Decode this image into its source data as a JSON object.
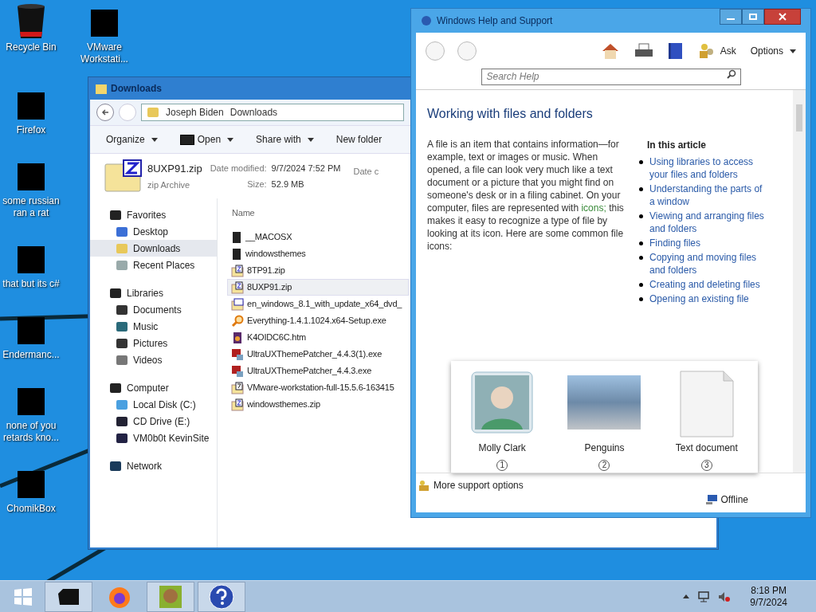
{
  "desktop_icons": [
    {
      "label": "Recycle Bin",
      "kind": "bin"
    },
    {
      "label": "VMware Workstati...",
      "kind": "redacted"
    },
    {
      "label": "Firefox",
      "kind": "redacted"
    },
    {
      "label": "some russian ran a rat",
      "kind": "redacted"
    },
    {
      "label": "that but its c#",
      "kind": "redacted"
    },
    {
      "label": "Endermanc...",
      "kind": "redacted"
    },
    {
      "label": "none of you retards kno...",
      "kind": "redacted"
    },
    {
      "label": "ChomikBox",
      "kind": "redacted"
    }
  ],
  "explorer": {
    "title": "Downloads",
    "breadcrumb": [
      "Joseph Biden",
      "Downloads"
    ],
    "toolbar": [
      {
        "label": "Organize",
        "dropdown": true,
        "kind": "plain"
      },
      {
        "label": "Open",
        "dropdown": true,
        "kind": "sevenzip"
      },
      {
        "label": "Share with",
        "dropdown": true,
        "kind": "plain"
      },
      {
        "label": "New folder",
        "dropdown": false,
        "kind": "plain"
      }
    ],
    "details": {
      "name": "8UXP91.zip",
      "type": "zip Archive",
      "modified_label": "Date modified:",
      "modified": "9/7/2024 7:52 PM",
      "size_label": "Size:",
      "size": "52.9 MB",
      "created_label": "Date c"
    },
    "nav": [
      {
        "label": "Favorites",
        "kind": "favorites",
        "children": [
          {
            "label": "Desktop",
            "kind": "desktop",
            "selected": false
          },
          {
            "label": "Downloads",
            "kind": "downloads",
            "selected": true
          },
          {
            "label": "Recent Places",
            "kind": "recent",
            "selected": false
          }
        ]
      },
      {
        "label": "Libraries",
        "kind": "libraries",
        "children": [
          {
            "label": "Documents",
            "kind": "documents",
            "selected": false
          },
          {
            "label": "Music",
            "kind": "music",
            "selected": false
          },
          {
            "label": "Pictures",
            "kind": "pictures",
            "selected": false
          },
          {
            "label": "Videos",
            "kind": "videos",
            "selected": false
          }
        ]
      },
      {
        "label": "Computer",
        "kind": "computer",
        "children": [
          {
            "label": "Local Disk (C:)",
            "kind": "disk",
            "selected": false
          },
          {
            "label": "CD Drive (E:)",
            "kind": "cd",
            "selected": false
          },
          {
            "label": "VM0b0t KevinSite",
            "kind": "network-drive",
            "selected": false
          }
        ]
      },
      {
        "label": "Network",
        "kind": "network"
      }
    ],
    "column": "Name",
    "files": [
      {
        "name": "__MACOSX",
        "kind": "folder",
        "selected": false
      },
      {
        "name": "windowsthemes",
        "kind": "folder",
        "selected": false
      },
      {
        "name": "8TP91.zip",
        "kind": "zip",
        "selected": false
      },
      {
        "name": "8UXP91.zip",
        "kind": "zip",
        "selected": true
      },
      {
        "name": "en_windows_8.1_with_update_x64_dvd_",
        "kind": "iso",
        "selected": false
      },
      {
        "name": "Everything-1.4.1.1024.x64-Setup.exe",
        "kind": "search-exe",
        "selected": false
      },
      {
        "name": "K4OIDC6C.htm",
        "kind": "htm",
        "selected": false
      },
      {
        "name": "UltraUXThemePatcher_4.4.3(1).exe",
        "kind": "patcher",
        "selected": false
      },
      {
        "name": "UltraUXThemePatcher_4.4.3.exe",
        "kind": "patcher",
        "selected": false
      },
      {
        "name": "VMware-workstation-full-15.5.6-163415",
        "kind": "sevenzip",
        "selected": false
      },
      {
        "name": "windowsthemes.zip",
        "kind": "zip",
        "selected": false
      }
    ]
  },
  "help": {
    "title": "Windows Help and Support",
    "ask": "Ask",
    "options": "Options",
    "search": {
      "placeholder": "Search Help"
    },
    "article_title": "Working with files and folders",
    "paragraph_before": "A file is an item that contains information—for example, text or images or music. When opened, a file can look very much like a text document or a picture that you might find on someone's desk or in a filing cabinet. On your computer, files are represented with ",
    "paragraph_link": "icons;",
    "paragraph_after": " this makes it easy to recognize a type of file by looking at its icon. Here are some common file icons:",
    "toc_heading": "In this article",
    "toc": [
      "Using libraries to access your files and folders",
      "Understanding the parts of a window",
      "Viewing and arranging files and folders",
      "Finding files",
      "Copying and moving files and folders",
      "Creating and deleting files",
      "Opening an existing file"
    ],
    "figure": [
      {
        "label": "Molly Clark",
        "number": "1",
        "kind": "contact"
      },
      {
        "label": "Penguins",
        "number": "2",
        "kind": "photo"
      },
      {
        "label": "Text document",
        "number": "3",
        "kind": "document"
      }
    ],
    "more_support": "More support options",
    "status": "Offline"
  },
  "taskbar": {
    "apps": [
      {
        "kind": "explorer",
        "selected": true
      },
      {
        "kind": "firefox",
        "selected": false
      },
      {
        "kind": "chomikbox",
        "selected": true
      },
      {
        "kind": "help",
        "selected": true
      }
    ],
    "time": "8:18 PM",
    "date": "9/7/2024"
  }
}
